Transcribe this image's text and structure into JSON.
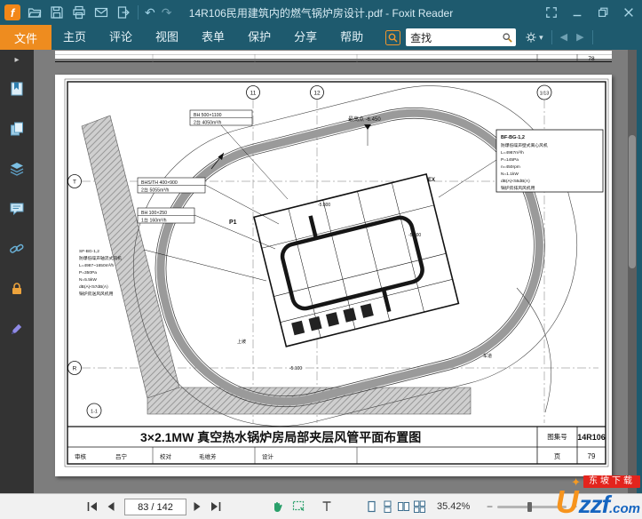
{
  "titlebar": {
    "title": "14R106民用建筑内的燃气锅炉房设计.pdf - Foxit Reader"
  },
  "menubar": {
    "file_tab": "文件",
    "items": [
      {
        "label": "主页"
      },
      {
        "label": "评论"
      },
      {
        "label": "视图"
      },
      {
        "label": "表单"
      },
      {
        "label": "保护"
      },
      {
        "label": "分享"
      },
      {
        "label": "帮助"
      }
    ],
    "search": {
      "value": "查找"
    }
  },
  "prev_page": {
    "page_no": "78"
  },
  "statusbar": {
    "page_field": "83 / 142",
    "zoom_text": "35.42%"
  },
  "watermark": {
    "badge": "东坡下载",
    "brand_u": "U",
    "brand_rest": "zzf",
    "brand_tld": ".com"
  },
  "drawing": {
    "grid": {
      "top1": "11",
      "top2": "12",
      "top3": "1/13",
      "left1": "T",
      "left2": "R",
      "corner": "1-1"
    },
    "ann": {
      "box1_r1": "BH 500×1100",
      "box1_r2": "2台 4050m³/h",
      "box2_r1": "BHS/TH 400×900",
      "box2_r2": "2台 5055m³/h",
      "box3_r1": "BH 100×250",
      "box3_r2": "1台 160m³/h",
      "left_block": [
        "SF-BG-1,2",
        "防爆低噪声轴流式风机",
        "L=4987~1650m³/h",
        "P=350Pa",
        "N=5.5kW",
        "dB(A)<57dB(A)",
        "锅炉房送风风机用"
      ],
      "right_title": "BF-BG-1,2",
      "right_block": [
        "防爆低噪声壁式离心风机",
        "L=4987m³/h",
        "P=145Pa",
        "n=450rpm",
        "N=1.1kW",
        "dB(A)<55dB(A)",
        "锅炉房排风风机用"
      ],
      "high_point": "最高点 -6.450",
      "elev1": "-5.800",
      "elev2": "-5.000",
      "elev3": "-5.100",
      "p1": "P1",
      "ramp": "上坡",
      "road": "车道",
      "ex": "EX"
    },
    "titleblock": {
      "title": "3×2.1MW 真空热水锅炉房局部夹层风管平面布置图",
      "atlas_label": "图集号",
      "atlas_no": "14R106",
      "page_label": "页",
      "page_no": "79",
      "r2c1_label": "审核",
      "r2c1_value": "吕宁",
      "r2c2_label": "校对",
      "r2c2_value": "毛维芳",
      "r2c3_label": "设计",
      "r2c3_value": ""
    }
  }
}
